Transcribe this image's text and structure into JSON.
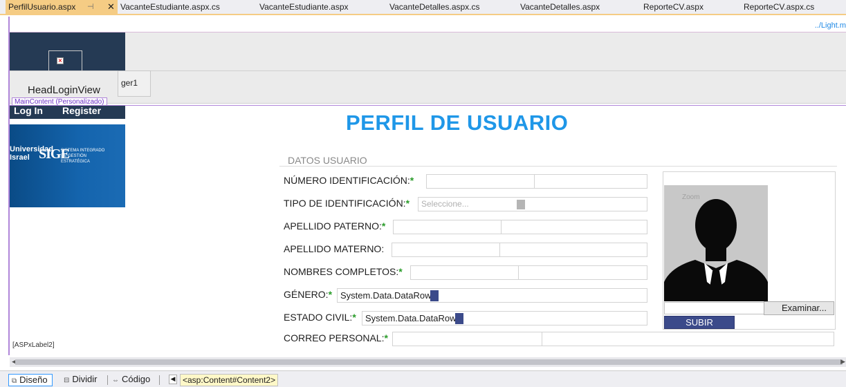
{
  "tabs": [
    {
      "label": "PerfilUsuario.aspx",
      "active": true,
      "pin": "⊣",
      "close": "✕"
    },
    {
      "label": "VacanteEstudiante.aspx.cs"
    },
    {
      "label": "VacanteEstudiante.aspx"
    },
    {
      "label": "VacanteDetalles.aspx.cs"
    },
    {
      "label": "VacanteDetalles.aspx"
    },
    {
      "label": "ReporteCV.aspx"
    },
    {
      "label": "ReporteCV.aspx.cs"
    }
  ],
  "master_path_hint": "../Light.m",
  "designer": {
    "manager_label": "ger1",
    "head_login_view": "HeadLoginView",
    "login_links": [
      "Log In",
      "Register"
    ],
    "main_content_tag": "MainContent (Personalizado)",
    "banner": {
      "logo_text": "Universidad Israel",
      "system_abbr": "SIGE",
      "system_name": "SISTEMA INTEGRADO DE GESTIÓN ESTRATÉGICA"
    },
    "aspx_label": "[ASPxLabel2]"
  },
  "page": {
    "title": "PERFIL DE USUARIO",
    "section": "DATOS USUARIO",
    "required_mark": "*"
  },
  "fields": {
    "numero_identificacion": {
      "label": "NÚMERO IDENTIFICACIÓN:",
      "required": true,
      "value": ""
    },
    "tipo_identificacion": {
      "label": "TIPO DE IDENTIFICACIÓN:",
      "required": true,
      "placeholder": "Seleccione..."
    },
    "apellido_paterno": {
      "label": "APELLIDO PATERNO:",
      "required": true,
      "value": ""
    },
    "apellido_materno": {
      "label": "APELLIDO MATERNO:",
      "required": false,
      "value": ""
    },
    "nombres_completos": {
      "label": "NOMBRES COMPLETOS:",
      "required": true,
      "value": ""
    },
    "genero": {
      "label": "GÉNERO:",
      "required": true,
      "value": "System.Data.DataRowView"
    },
    "estado_civil": {
      "label": "ESTADO CIVIL:",
      "required": true,
      "value": "System.Data.DataRowView"
    },
    "correo_personal": {
      "label": "CORREO PERSONAL:",
      "required": true,
      "value": ""
    }
  },
  "photo": {
    "zoom_label": "Zoom",
    "browse_label": "Examinar...",
    "upload_label": "SUBIR"
  },
  "statusbar": {
    "views": [
      {
        "label": "Diseño",
        "icon": "design-view-icon",
        "glyph": "⧉"
      },
      {
        "label": "Dividir",
        "icon": "split-view-icon",
        "glyph": "⊟"
      },
      {
        "label": "Código",
        "icon": "code-view-icon",
        "glyph": "⇔"
      }
    ],
    "breadcrumb": "<asp:Content#Content2>"
  },
  "colors": {
    "title": "#1f97e8",
    "active_tab": "#f5cc84",
    "required": "#2a9c2a",
    "button_dark": "#3b4a8a",
    "content_border": "#b086d9"
  }
}
